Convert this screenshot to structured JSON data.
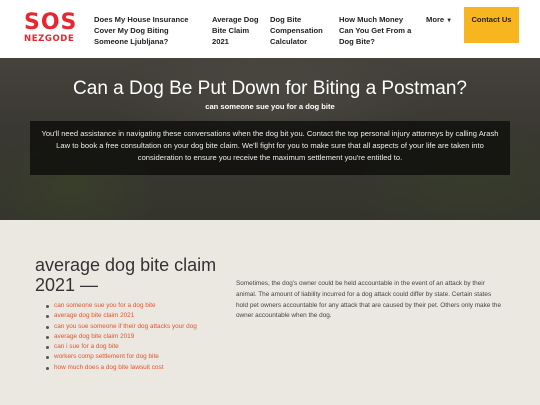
{
  "header": {
    "logo": {
      "top": "SOS",
      "bottom": "NEZGODE"
    },
    "nav": [
      {
        "label": "Does My House Insurance Cover My Dog Biting Someone Ljubljana?"
      },
      {
        "label": "Average Dog Bite Claim 2021"
      },
      {
        "label": "Dog Bite Compensation Calculator"
      },
      {
        "label": "How Much Money Can You Get From a Dog Bite?"
      },
      {
        "label": "More"
      }
    ],
    "cta": "Contact Us"
  },
  "hero": {
    "title": "Can a Dog Be Put Down for Biting a Postman?",
    "subtitle": "can someone sue you for a dog bite",
    "body": "You'll need assistance in navigating these conversations when the dog bit you. Contact the top personal injury attorneys by calling Arash Law to book a free consultation on your dog bite claim. We'll fight for you to make sure that all aspects of your life are taken into consideration to ensure you receive the maximum settlement you're entitled to."
  },
  "main": {
    "section_title": "average dog bite claim 2021 —",
    "links": [
      "can someone sue you for a dog bite",
      "average dog bite claim 2021",
      "can you sue someone if their dog attacks your dog",
      "average dog bite claim 2019",
      "can i sue for a dog bite",
      "workers comp settlement for dog bite",
      "how much does a dog bite lawsuit cost"
    ],
    "body": "Sometimes, the dog's owner could be held accountable in the event of an attack by their animal. The amount of liability incurred for a dog attack could differ by state. Certain states hold pet owners accountable for any attack that are caused by their pet. Others only make the owner accountable when the dog."
  },
  "colors": {
    "brand": "#e8262e",
    "cta": "#f7b620",
    "link": "#e8522d",
    "background": "#ebe8e1"
  }
}
